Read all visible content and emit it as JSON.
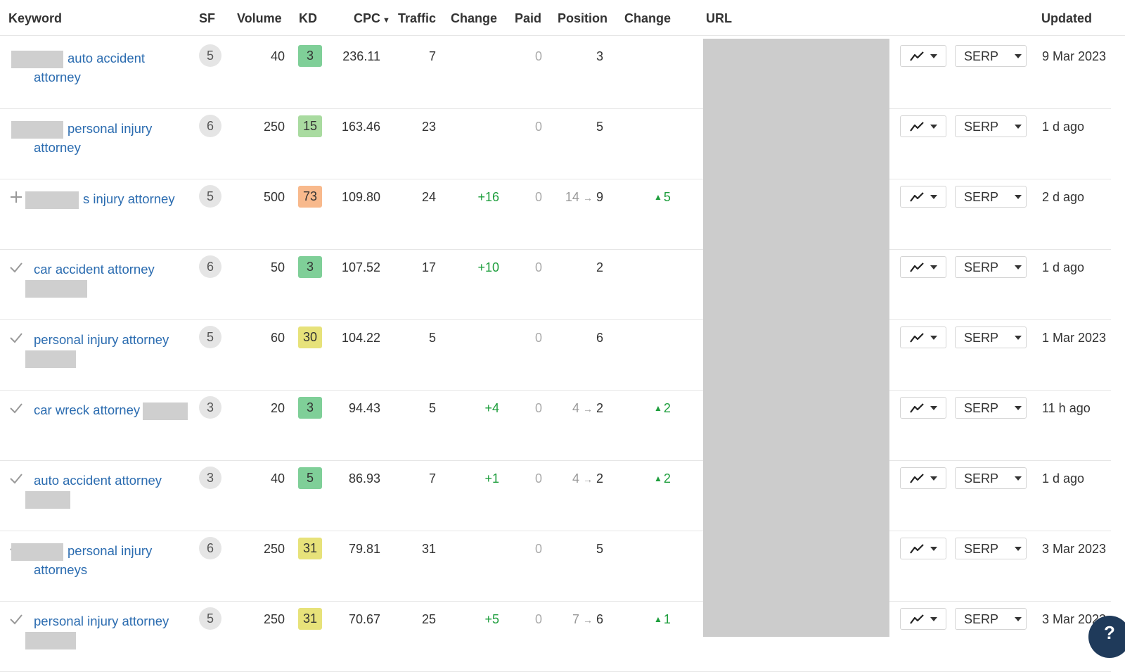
{
  "header": {
    "keyword": "Keyword",
    "sf": "SF",
    "volume": "Volume",
    "kd": "KD",
    "cpc": "CPC",
    "traffic": "Traffic",
    "change": "Change",
    "paid": "Paid",
    "position": "Position",
    "change2": "Change",
    "url": "URL",
    "updated": "Updated"
  },
  "serp_label": "SERP",
  "help_label": "?",
  "colors": {
    "link": "#2b6cb0",
    "green": "#1e9e3d",
    "kd_green": "#7fcf98",
    "kd_lightgreen": "#a9dba0",
    "kd_yellow": "#e7e27a",
    "kd_orange": "#f8b98c"
  },
  "rows": [
    {
      "mark": "none",
      "kw_line1": "auto accident",
      "kw_line2": "attorney",
      "blur_pos": "before",
      "sf": "5",
      "volume": "40",
      "kd": "3",
      "kd_color": "#7fcf98",
      "cpc": "236.11",
      "traffic": "7",
      "change": "",
      "paid": "0",
      "pos_prev": "",
      "pos": "3",
      "pos_change": "",
      "updated": "9 Mar 2023"
    },
    {
      "mark": "none",
      "kw_line1": "personal injury",
      "kw_line2": "attorney",
      "blur_pos": "before",
      "sf": "6",
      "volume": "250",
      "kd": "15",
      "kd_color": "#a9dba0",
      "cpc": "163.46",
      "traffic": "23",
      "change": "",
      "paid": "0",
      "pos_prev": "",
      "pos": "5",
      "pos_change": "",
      "updated": "1 d ago"
    },
    {
      "mark": "plus",
      "kw_line1": "s injury attorney",
      "kw_line2": "",
      "blur_pos": "before",
      "sf": "5",
      "volume": "500",
      "kd": "73",
      "kd_color": "#f8b98c",
      "cpc": "109.80",
      "traffic": "24",
      "change": "+16",
      "paid": "0",
      "pos_prev": "14",
      "pos": "9",
      "pos_change": "5",
      "updated": "2 d ago"
    },
    {
      "mark": "check",
      "kw_line1": "car accident attorney",
      "kw_line2": "",
      "blur_pos": "below",
      "sf": "6",
      "volume": "50",
      "kd": "3",
      "kd_color": "#7fcf98",
      "cpc": "107.52",
      "traffic": "17",
      "change": "+10",
      "paid": "0",
      "pos_prev": "",
      "pos": "2",
      "pos_change": "",
      "updated": "1 d ago"
    },
    {
      "mark": "check",
      "kw_line1": "personal injury attorney",
      "kw_line2": "",
      "blur_pos": "below",
      "sf": "5",
      "volume": "60",
      "kd": "30",
      "kd_color": "#e7e27a",
      "cpc": "104.22",
      "traffic": "5",
      "change": "",
      "paid": "0",
      "pos_prev": "",
      "pos": "6",
      "pos_change": "",
      "updated": "1 Mar 2023"
    },
    {
      "mark": "check",
      "kw_line1": "car wreck attorney",
      "kw_line2": "",
      "blur_pos": "after",
      "sf": "3",
      "volume": "20",
      "kd": "3",
      "kd_color": "#7fcf98",
      "cpc": "94.43",
      "traffic": "5",
      "change": "+4",
      "paid": "0",
      "pos_prev": "4",
      "pos": "2",
      "pos_change": "2",
      "updated": "11 h ago"
    },
    {
      "mark": "check",
      "kw_line1": "auto accident attorney",
      "kw_line2": "",
      "blur_pos": "below",
      "sf": "3",
      "volume": "40",
      "kd": "5",
      "kd_color": "#7fcf98",
      "cpc": "86.93",
      "traffic": "7",
      "change": "+1",
      "paid": "0",
      "pos_prev": "4",
      "pos": "2",
      "pos_change": "2",
      "updated": "1 d ago"
    },
    {
      "mark": "check",
      "kw_line1": "personal injury",
      "kw_line2": "attorneys",
      "blur_pos": "before",
      "sf": "6",
      "volume": "250",
      "kd": "31",
      "kd_color": "#e7e27a",
      "cpc": "79.81",
      "traffic": "31",
      "change": "",
      "paid": "0",
      "pos_prev": "",
      "pos": "5",
      "pos_change": "",
      "updated": "3 Mar 2023"
    },
    {
      "mark": "check",
      "kw_line1": "personal injury attorney",
      "kw_line2": "",
      "blur_pos": "below",
      "sf": "5",
      "volume": "250",
      "kd": "31",
      "kd_color": "#e7e27a",
      "cpc": "70.67",
      "traffic": "25",
      "change": "+5",
      "paid": "0",
      "pos_prev": "7",
      "pos": "6",
      "pos_change": "1",
      "updated": "3 Mar 2023"
    }
  ]
}
